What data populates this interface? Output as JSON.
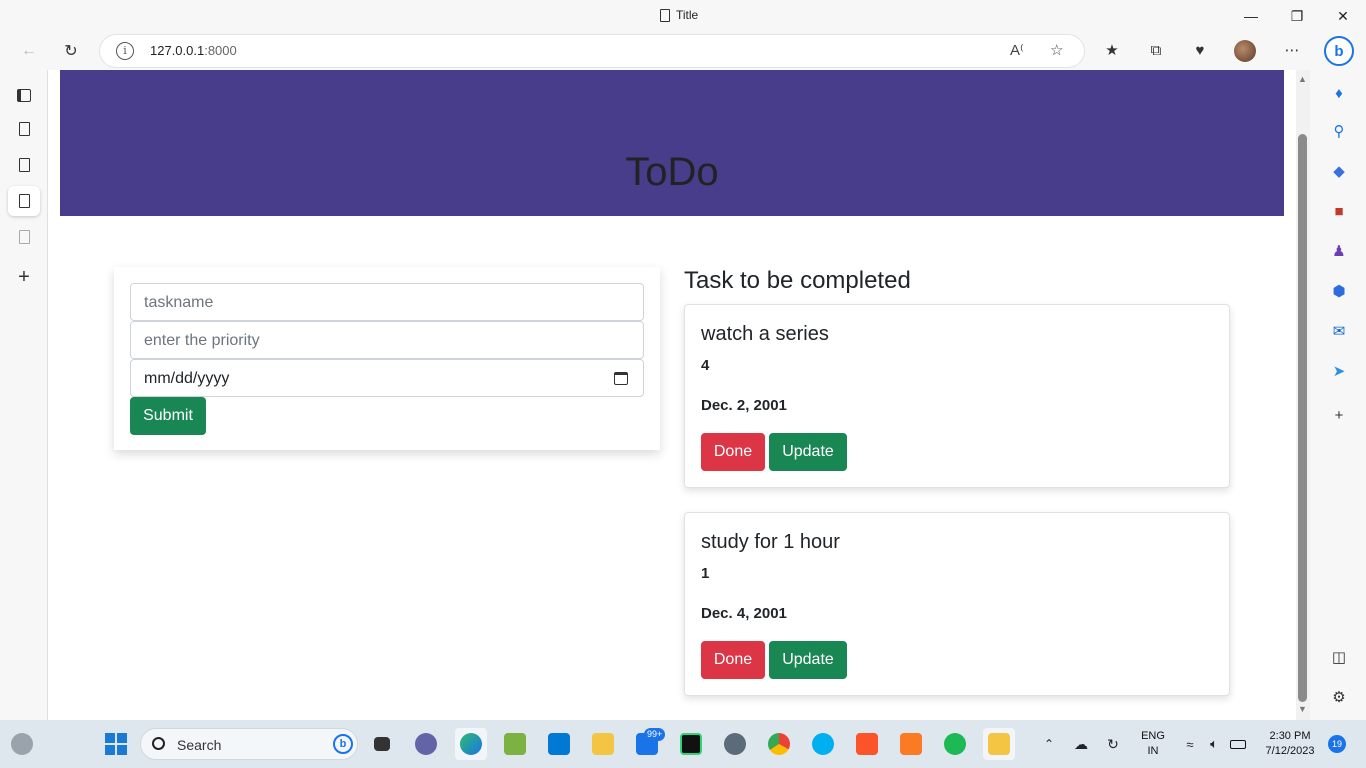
{
  "window": {
    "title": "Title"
  },
  "browser": {
    "url_host": "127.0.0.1",
    "url_port": ":8000"
  },
  "page": {
    "heading": "ToDo",
    "form": {
      "taskname_placeholder": "taskname",
      "priority_placeholder": "enter the priority",
      "date_placeholder": "mm/dd/yyyy",
      "submit_label": "Submit"
    },
    "tasks_heading": "Task to be completed",
    "tasks": [
      {
        "name": "watch a series",
        "priority": "4",
        "date": "Dec. 2, 2001",
        "done_label": "Done",
        "update_label": "Update"
      },
      {
        "name": "study for 1 hour",
        "priority": "1",
        "date": "Dec. 4, 2001",
        "done_label": "Done",
        "update_label": "Update"
      }
    ]
  },
  "taskbar": {
    "search_label": "Search",
    "mail_badge": "99+",
    "lang_line1": "ENG",
    "lang_line2": "IN",
    "time": "2:30 PM",
    "date": "7/12/2023",
    "notification_count": "19"
  },
  "colors": {
    "hero": "#483d8b",
    "btn_green": "#198754",
    "btn_red": "#dc3545",
    "accent": "#1a73e8"
  }
}
